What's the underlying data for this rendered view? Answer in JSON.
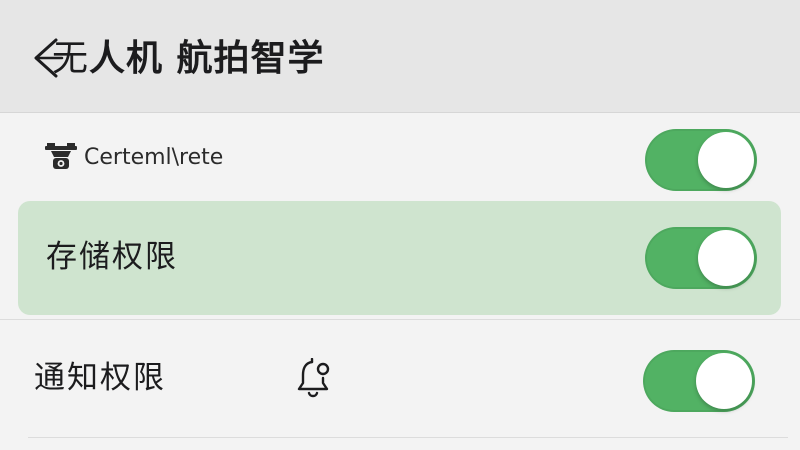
{
  "header": {
    "title_first_char": "无",
    "title_rest": "人机 航拍智学",
    "back_icon": "chevron-left-icon"
  },
  "settings": {
    "items": [
      {
        "label": "Certeml\\rete",
        "icon": "drone-camera-icon",
        "enabled": true
      },
      {
        "label": "存储权限",
        "enabled": true,
        "highlighted": true
      },
      {
        "label": "通知权限",
        "icon": "bell-icon",
        "enabled": true
      }
    ]
  },
  "colors": {
    "toggle_on": "#52b264",
    "highlight_row": "#cfe4cf",
    "header_bg": "#e6e6e6"
  }
}
